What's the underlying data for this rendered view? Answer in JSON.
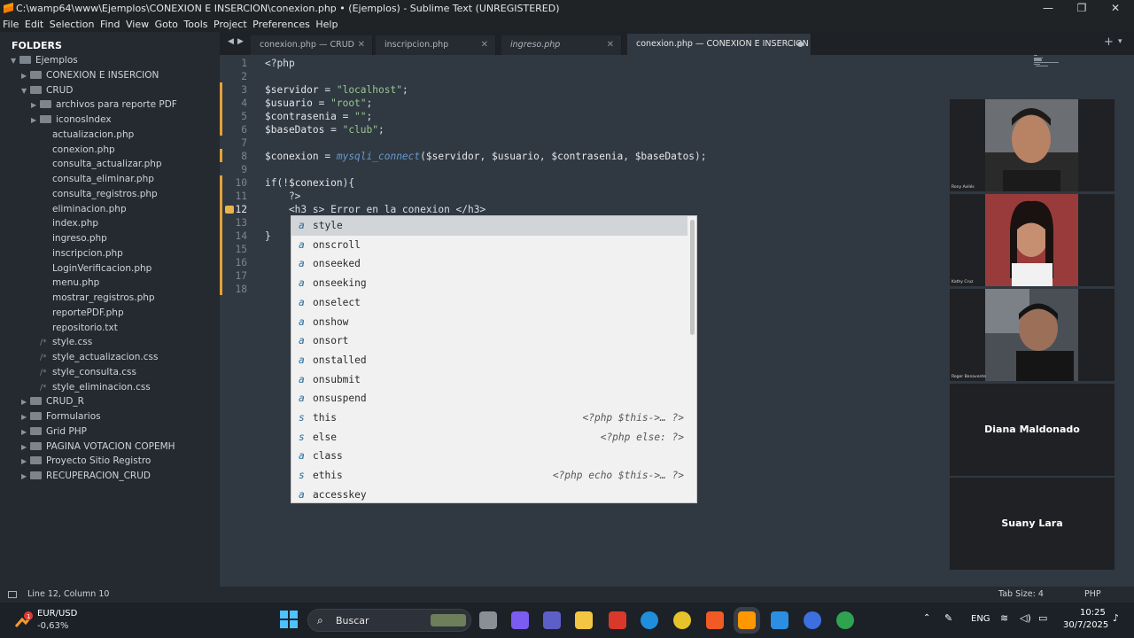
{
  "window": {
    "title": "C:\\wamp64\\www\\Ejemplos\\CONEXION E INSERCION\\conexion.php • (Ejemplos) - Sublime Text (UNREGISTERED)",
    "minimize": "—",
    "maximize": "❐",
    "close": "✕"
  },
  "menu": [
    "File",
    "Edit",
    "Selection",
    "Find",
    "View",
    "Goto",
    "Tools",
    "Project",
    "Preferences",
    "Help"
  ],
  "sidebar": {
    "title": "FOLDERS",
    "items": [
      {
        "label": "Ejemplos",
        "type": "folder-open",
        "depth": 0
      },
      {
        "label": "CONEXION E INSERCION",
        "type": "folder",
        "depth": 1
      },
      {
        "label": "CRUD",
        "type": "folder-open",
        "depth": 1
      },
      {
        "label": "archivos para reporte PDF",
        "type": "folder",
        "depth": 2
      },
      {
        "label": "iconosIndex",
        "type": "folder",
        "depth": 2
      },
      {
        "label": "actualizacion.php",
        "type": "file",
        "depth": 2
      },
      {
        "label": "conexion.php",
        "type": "file",
        "depth": 2
      },
      {
        "label": "consulta_actualizar.php",
        "type": "file",
        "depth": 2
      },
      {
        "label": "consulta_eliminar.php",
        "type": "file",
        "depth": 2
      },
      {
        "label": "consulta_registros.php",
        "type": "file",
        "depth": 2
      },
      {
        "label": "eliminacion.php",
        "type": "file",
        "depth": 2
      },
      {
        "label": "index.php",
        "type": "file",
        "depth": 2
      },
      {
        "label": "ingreso.php",
        "type": "file",
        "depth": 2
      },
      {
        "label": "inscripcion.php",
        "type": "file",
        "depth": 2
      },
      {
        "label": "LoginVerificacion.php",
        "type": "file",
        "depth": 2
      },
      {
        "label": "menu.php",
        "type": "file",
        "depth": 2
      },
      {
        "label": "mostrar_registros.php",
        "type": "file",
        "depth": 2
      },
      {
        "label": "reportePDF.php",
        "type": "file",
        "depth": 2
      },
      {
        "label": "repositorio.txt",
        "type": "file",
        "depth": 2
      },
      {
        "label": "style.css",
        "type": "css",
        "depth": 2
      },
      {
        "label": "style_actualizacion.css",
        "type": "css",
        "depth": 2
      },
      {
        "label": "style_consulta.css",
        "type": "css",
        "depth": 2
      },
      {
        "label": "style_eliminacion.css",
        "type": "css",
        "depth": 2
      },
      {
        "label": "CRUD_R",
        "type": "folder",
        "depth": 1
      },
      {
        "label": "Formularios",
        "type": "folder",
        "depth": 1
      },
      {
        "label": "Grid PHP",
        "type": "folder",
        "depth": 1
      },
      {
        "label": "PAGINA VOTACION COPEMH",
        "type": "folder",
        "depth": 1
      },
      {
        "label": "Proyecto Sitio Registro",
        "type": "folder",
        "depth": 1
      },
      {
        "label": "RECUPERACION_CRUD",
        "type": "folder",
        "depth": 1
      }
    ]
  },
  "tabs": [
    {
      "label": "conexion.php — CRUD",
      "active": false,
      "italic": false
    },
    {
      "label": "inscripcion.php",
      "active": false,
      "italic": false
    },
    {
      "label": "ingreso.php",
      "active": false,
      "italic": true
    },
    {
      "label": "conexion.php — CONEXION E INSERCION",
      "active": true,
      "italic": false
    }
  ],
  "tab_nav": {
    "prev": "◀",
    "next": "▶",
    "add": "+",
    "more": "▾"
  },
  "editor": {
    "current_line": "12",
    "lines": [
      {
        "n": "1",
        "code": "<?php"
      },
      {
        "n": "2",
        "code": ""
      },
      {
        "n": "3",
        "code": "$servidor = \"localhost\";"
      },
      {
        "n": "4",
        "code": "$usuario = \"root\";"
      },
      {
        "n": "5",
        "code": "$contrasenia = \"\";"
      },
      {
        "n": "6",
        "code": "$baseDatos = \"club\";"
      },
      {
        "n": "7",
        "code": ""
      },
      {
        "n": "8",
        "code": "$conexion = mysqli_connect($servidor, $usuario, $contrasenia, $baseDatos);"
      },
      {
        "n": "9",
        "code": ""
      },
      {
        "n": "10",
        "code": "if(!$conexion){"
      },
      {
        "n": "11",
        "code": "    ?>"
      },
      {
        "n": "12",
        "code": "    <h3 s> Error en la conexion </h3>"
      },
      {
        "n": "13",
        "code": ""
      },
      {
        "n": "14",
        "code": "}"
      },
      {
        "n": "15",
        "code": ""
      },
      {
        "n": "16",
        "code": ""
      },
      {
        "n": "17",
        "code": ""
      },
      {
        "n": "18",
        "code": ""
      }
    ]
  },
  "autocomplete": [
    {
      "kind": "a",
      "label": "style",
      "hint": "",
      "selected": true
    },
    {
      "kind": "a",
      "label": "onscroll",
      "hint": ""
    },
    {
      "kind": "a",
      "label": "onseeked",
      "hint": ""
    },
    {
      "kind": "a",
      "label": "onseeking",
      "hint": ""
    },
    {
      "kind": "a",
      "label": "onselect",
      "hint": ""
    },
    {
      "kind": "a",
      "label": "onshow",
      "hint": ""
    },
    {
      "kind": "a",
      "label": "onsort",
      "hint": ""
    },
    {
      "kind": "a",
      "label": "onstalled",
      "hint": ""
    },
    {
      "kind": "a",
      "label": "onsubmit",
      "hint": ""
    },
    {
      "kind": "a",
      "label": "onsuspend",
      "hint": ""
    },
    {
      "kind": "s",
      "label": "this",
      "hint": "<?php $this->… ?>"
    },
    {
      "kind": "s",
      "label": "else",
      "hint": "<?php else: ?>"
    },
    {
      "kind": "a",
      "label": "class",
      "hint": ""
    },
    {
      "kind": "s",
      "label": "ethis",
      "hint": "<?php echo $this->… ?>"
    },
    {
      "kind": "a",
      "label": "accesskey",
      "hint": ""
    }
  ],
  "video_call": [
    {
      "name": "Rony Avilés",
      "has_video": true
    },
    {
      "name": "Kathy Cruz",
      "has_video": true
    },
    {
      "name": "Roger Benavente",
      "has_video": true
    },
    {
      "name": "Diana Maldonado",
      "has_video": false
    },
    {
      "name": "Suany Lara",
      "has_video": false
    }
  ],
  "status": {
    "position": "Line 12, Column 10",
    "tab_size": "Tab Size: 4",
    "syntax": "PHP"
  },
  "taskbar": {
    "weather_title": "EUR/USD",
    "weather_value": "-0,63%",
    "search_placeholder": "Buscar",
    "lang": "ENG",
    "time": "10:25",
    "date": "30/7/2025"
  },
  "colors": {
    "editor_bg": "#303841",
    "sidebar_bg": "#252a30",
    "string": "#99c794",
    "function": "#6699cc",
    "modified_marker": "#e4a13a"
  }
}
